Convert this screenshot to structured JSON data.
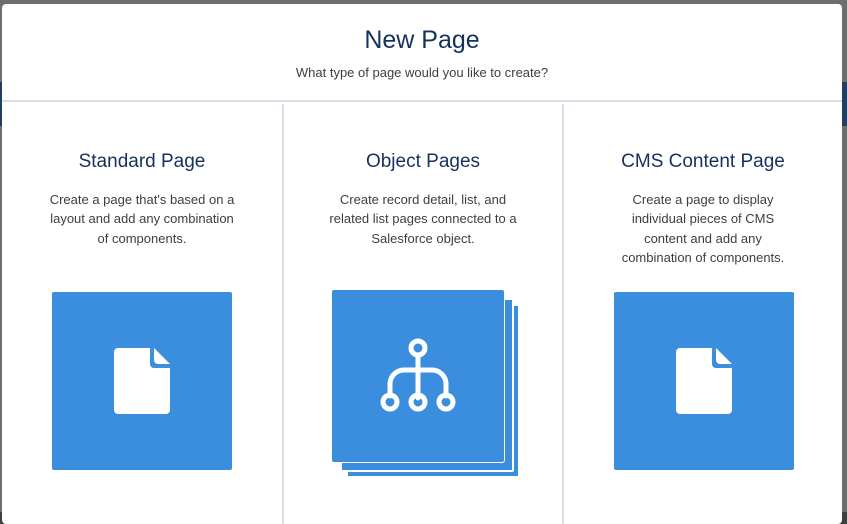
{
  "modal": {
    "title": "New Page",
    "subtitle": "What type of page would you like to create?"
  },
  "options": [
    {
      "title": "Standard Page",
      "description": "Create a page that's based on a layout and add any combination of components.",
      "icon": "document-icon"
    },
    {
      "title": "Object Pages",
      "description": "Create record detail, list, and related list pages connected to a Salesforce object.",
      "icon": "hierarchy-icon"
    },
    {
      "title": "CMS Content Page",
      "description": "Create a page to display individual pieces of CMS content and add any combination of components.",
      "icon": "document-icon"
    }
  ],
  "colors": {
    "tile": "#3b8ddd",
    "title": "#16325c",
    "text": "#3e3e3c",
    "divider": "#d8dde6"
  }
}
